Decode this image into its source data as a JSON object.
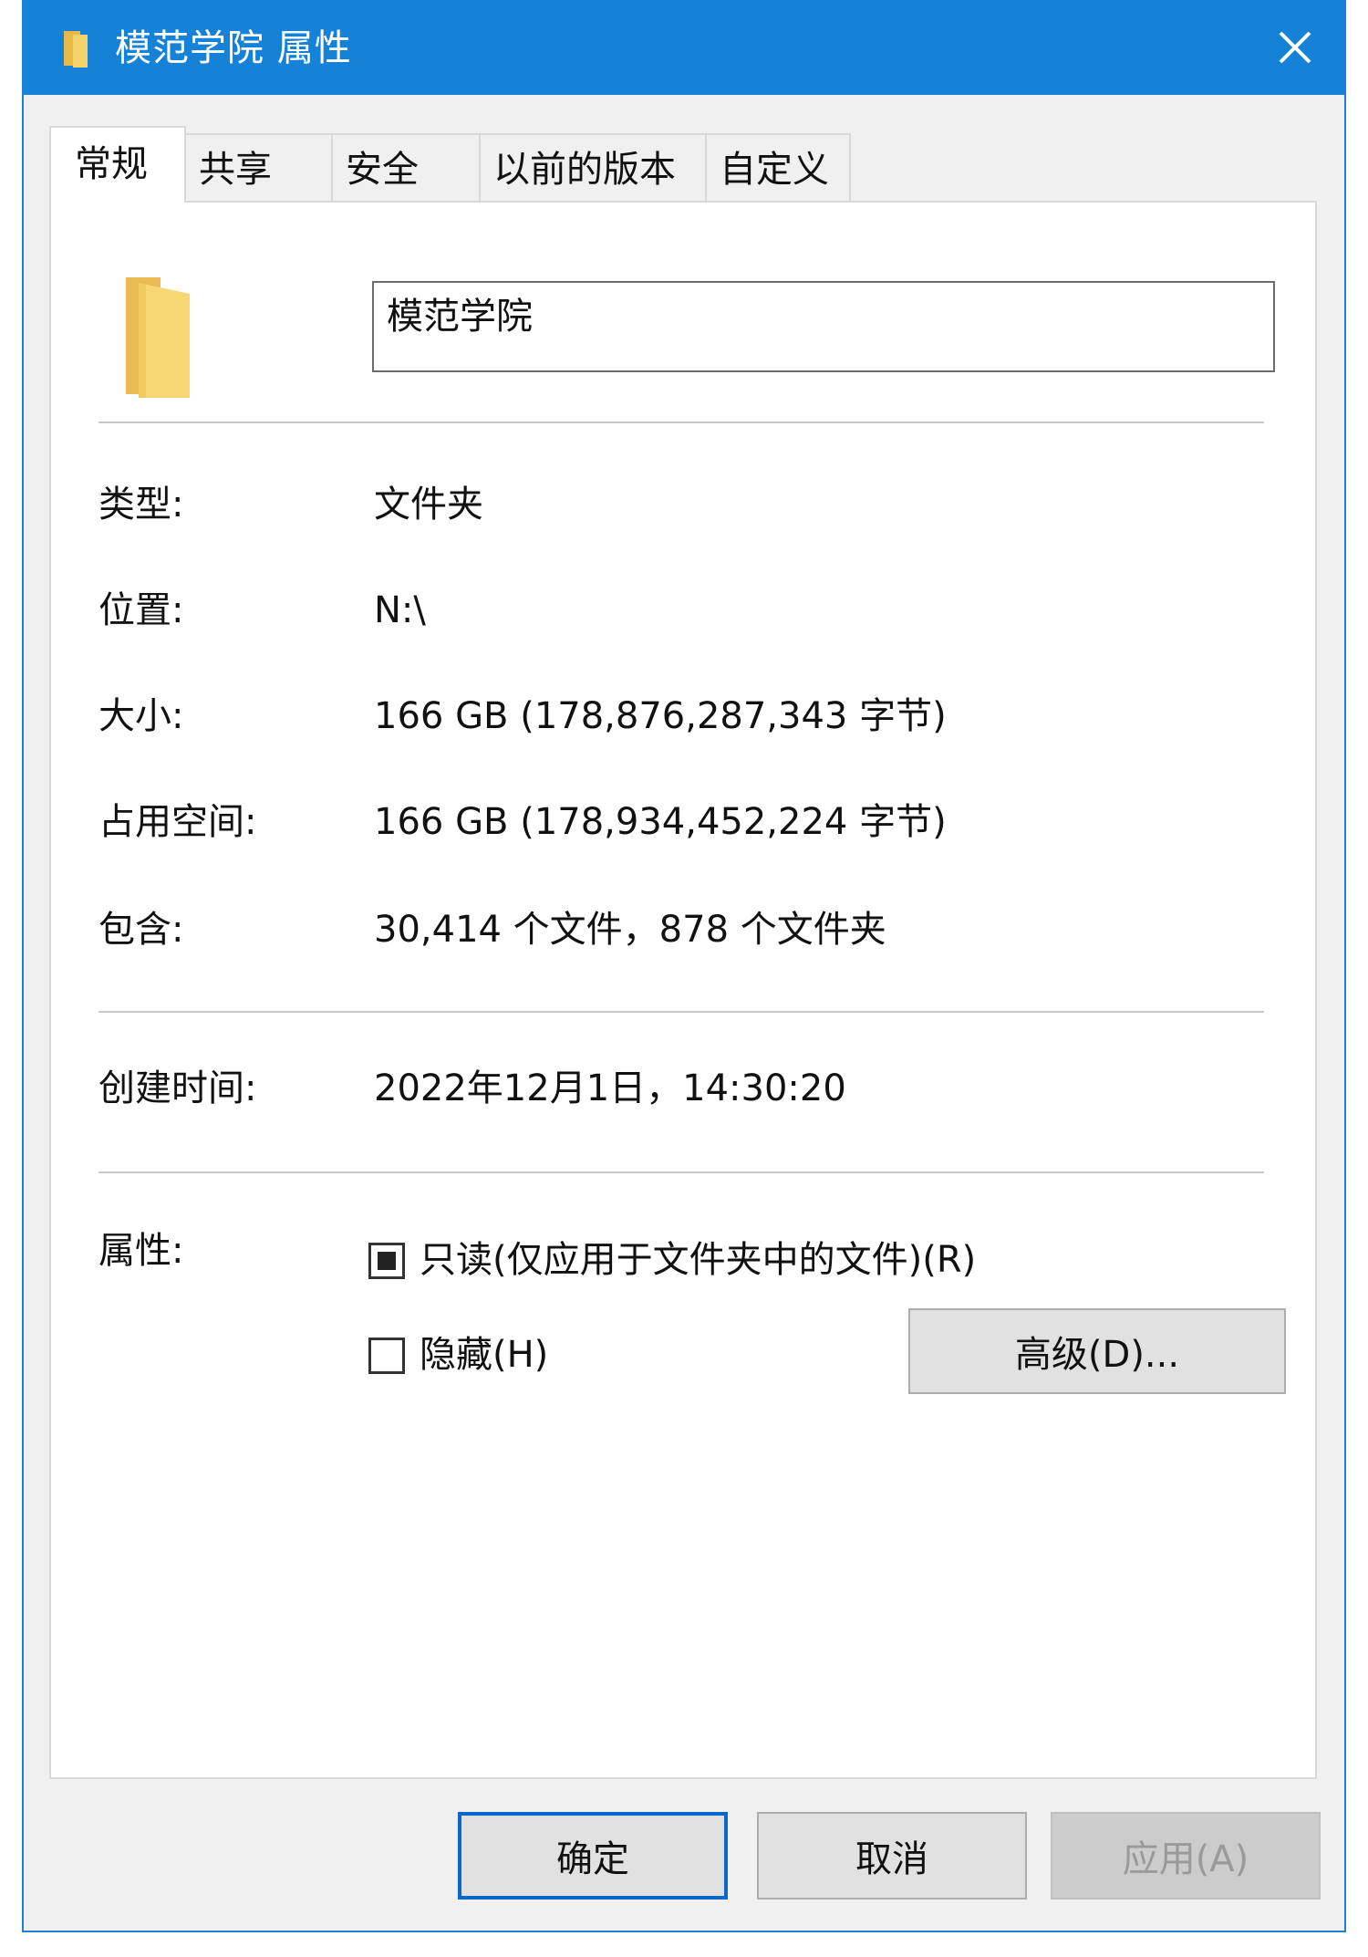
{
  "window": {
    "title": "模范学院 属性"
  },
  "tabs": [
    {
      "label": "常规",
      "active": true
    },
    {
      "label": "共享"
    },
    {
      "label": "安全"
    },
    {
      "label": "以前的版本"
    },
    {
      "label": "自定义"
    }
  ],
  "general": {
    "folder_name": "模范学院",
    "type": {
      "label": "类型:",
      "value": "文件夹"
    },
    "location": {
      "label": "位置:",
      "value": "N:\\"
    },
    "size": {
      "label": "大小:",
      "value": "166 GB (178,876,287,343 字节)"
    },
    "size_on_disk": {
      "label": "占用空间:",
      "value": "166 GB (178,934,452,224 字节)"
    },
    "contains": {
      "label": "包含:",
      "value": "30,414 个文件，878 个文件夹"
    },
    "created": {
      "label": "创建时间:",
      "value": "2022年12月1日，14:30:20"
    },
    "attributes": {
      "label": "属性:",
      "readonly": {
        "label": "只读(仅应用于文件夹中的文件)(R)",
        "state": "indeterminate"
      },
      "hidden": {
        "label": "隐藏(H)",
        "state": "unchecked"
      },
      "advanced_button": "高级(D)..."
    }
  },
  "buttons": {
    "ok": "确定",
    "cancel": "取消",
    "apply": "应用(A)"
  },
  "colors": {
    "titlebar": "#1581d7",
    "folder_yellow": "#f2c94c",
    "default_button_border": "#0a66c9"
  }
}
